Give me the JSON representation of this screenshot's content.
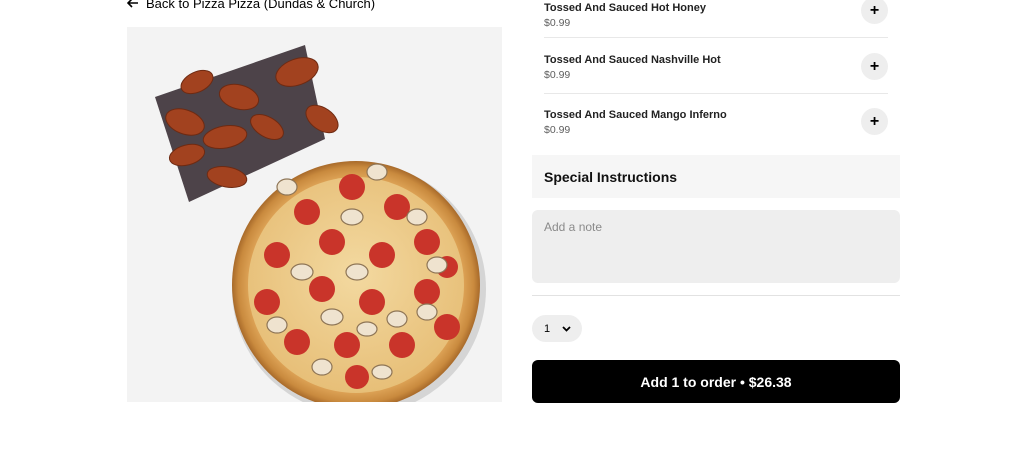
{
  "back_link": {
    "label": "Back to Pizza Pizza (Dundas & Church)",
    "icon": "arrow-left-icon"
  },
  "hero_image": {
    "alt": "Pizza and wings"
  },
  "options": [
    {
      "name": "Tossed And Sauced Hot Honey",
      "price": "$0.99",
      "add_icon": "+"
    },
    {
      "name": "Tossed And Sauced Nashville Hot",
      "price": "$0.99",
      "add_icon": "+"
    },
    {
      "name": "Tossed And Sauced Mango Inferno",
      "price": "$0.99",
      "add_icon": "+"
    }
  ],
  "special_instructions": {
    "title": "Special Instructions",
    "placeholder": "Add a note"
  },
  "quantity": {
    "value": "1",
    "icon": "chevron-down-icon"
  },
  "add_to_order": {
    "label": "Add 1 to order • $26.38"
  },
  "colors": {
    "primary_button": "#000000",
    "surface": "#eeeeee"
  }
}
